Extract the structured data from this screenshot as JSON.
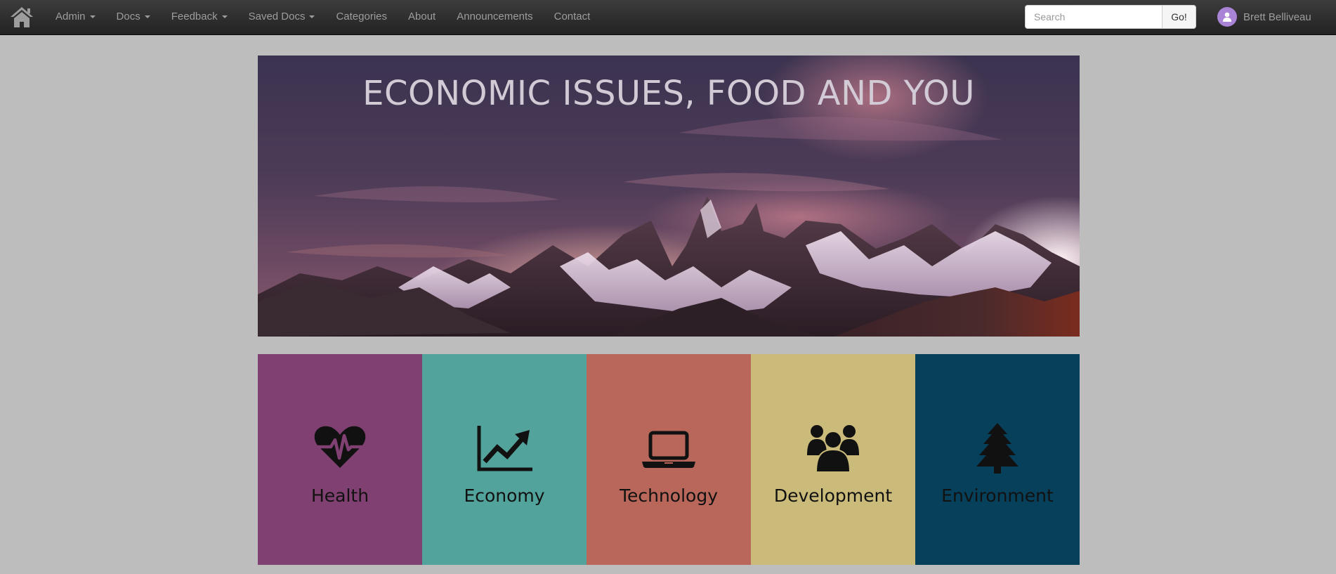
{
  "navbar": {
    "home_icon": "home-icon",
    "items": [
      {
        "label": "Admin",
        "dropdown": true
      },
      {
        "label": "Docs",
        "dropdown": true
      },
      {
        "label": "Feedback",
        "dropdown": true
      },
      {
        "label": "Saved Docs",
        "dropdown": true
      },
      {
        "label": "Categories",
        "dropdown": false
      },
      {
        "label": "About",
        "dropdown": false
      },
      {
        "label": "Announcements",
        "dropdown": false
      },
      {
        "label": "Contact",
        "dropdown": false
      }
    ],
    "search": {
      "placeholder": "Search",
      "value": "",
      "button_label": "Go!"
    },
    "user": {
      "name": "Brett Belliveau",
      "avatar_icon": "user-avatar-icon",
      "avatar_color": "#a983d6"
    }
  },
  "hero": {
    "title": "ECONOMIC ISSUES, FOOD AND YOU"
  },
  "categories": [
    {
      "label": "Health",
      "icon": "heartbeat-icon",
      "color": "#804072"
    },
    {
      "label": "Economy",
      "icon": "line-chart-icon",
      "color": "#52a39b"
    },
    {
      "label": "Technology",
      "icon": "laptop-icon",
      "color": "#b8675a"
    },
    {
      "label": "Development",
      "icon": "users-icon",
      "color": "#cbbb7a"
    },
    {
      "label": "Environment",
      "icon": "tree-icon",
      "color": "#07405b"
    }
  ]
}
